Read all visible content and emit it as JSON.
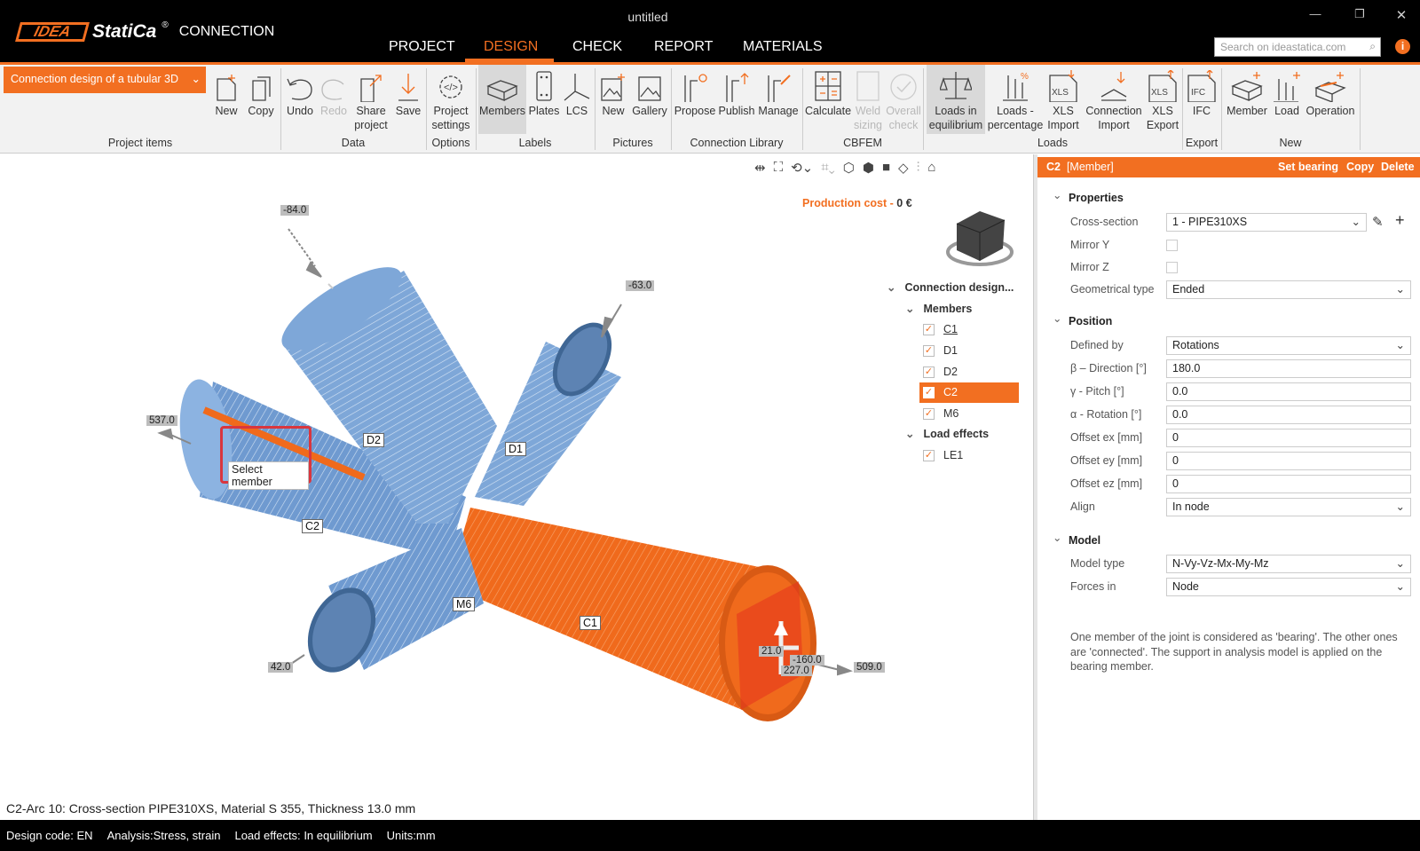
{
  "app": {
    "logo": "IDEA",
    "logo2": "StatiCa",
    "logo_reg": "®",
    "product": "CONNECTION",
    "window_title": "untitled",
    "search_placeholder": "Search on ideastatica.com"
  },
  "menu": [
    "PROJECT",
    "DESIGN",
    "CHECK",
    "REPORT",
    "MATERIALS"
  ],
  "ribbon": {
    "project_dropdown": "Connection design of a tubular 3D",
    "groups": {
      "project_items": "Project items",
      "data": "Data",
      "options": "Options",
      "labels": "Labels",
      "pictures": "Pictures",
      "connection_library": "Connection Library",
      "cbfem": "CBFEM",
      "loads": "Loads",
      "export": "Export",
      "new": "New"
    },
    "buttons": {
      "new": "New",
      "copy": "Copy",
      "undo": "Undo",
      "redo": "Redo",
      "share1": "Share",
      "share2": "project",
      "save": "Save",
      "ps1": "Project",
      "ps2": "settings",
      "members": "Members",
      "plates": "Plates",
      "lcs": "LCS",
      "pic_new": "New",
      "gallery": "Gallery",
      "propose": "Propose",
      "publish": "Publish",
      "manage": "Manage",
      "calculate": "Calculate",
      "weld1": "Weld",
      "weld2": "sizing",
      "overall1": "Overall",
      "overall2": "check",
      "lie1": "Loads in",
      "lie2": "equilibrium",
      "lp1": "Loads -",
      "lp2": "percentage",
      "xi1": "XLS",
      "xi2": "Import",
      "ci1": "Connection",
      "ci2": "Import",
      "xe1": "XLS",
      "xe2": "Export",
      "ifc": "IFC",
      "member": "Member",
      "load": "Load",
      "operation": "Operation"
    }
  },
  "viewport": {
    "production_cost_label": "Production cost",
    "production_cost_value": "0 €",
    "members": {
      "d2": "D2",
      "d1": "D1",
      "c2": "C2",
      "m6": "M6",
      "c1": "C1"
    },
    "loads": {
      "a": "-84.0",
      "b": "-63.0",
      "c": "537.0",
      "d": "42.0",
      "e": "509.0",
      "f": "21.0",
      "g": "-160.0",
      "h": "227.0"
    },
    "tooltip": "Select member"
  },
  "tree": {
    "root": "Connection design...",
    "members_label": "Members",
    "members": [
      "C1",
      "D1",
      "D2",
      "C2",
      "M6"
    ],
    "load_effects_label": "Load effects",
    "load_effects": [
      "LE1"
    ]
  },
  "panel": {
    "header_id": "C2",
    "header_type": "[Member]",
    "set_bearing": "Set bearing",
    "copy": "Copy",
    "delete": "Delete",
    "properties": "Properties",
    "cross_section_label": "Cross-section",
    "cross_section": "1 - PIPE310XS",
    "mirror_y": "Mirror Y",
    "mirror_z": "Mirror Z",
    "geom_type_label": "Geometrical type",
    "geom_type": "Ended",
    "position": "Position",
    "defined_by_label": "Defined by",
    "defined_by": "Rotations",
    "beta_label": "β – Direction [°]",
    "beta": "180.0",
    "gamma_label": "γ - Pitch [°]",
    "gamma": "0.0",
    "alpha_label": "α - Rotation [°]",
    "alpha": "0.0",
    "ex_label": "Offset ex [mm]",
    "ex": "0",
    "ey_label": "Offset ey [mm]",
    "ey": "0",
    "ez_label": "Offset ez [mm]",
    "ez": "0",
    "align_label": "Align",
    "align": "In node",
    "model": "Model",
    "model_type_label": "Model type",
    "model_type": "N-Vy-Vz-Mx-My-Mz",
    "forces_in_label": "Forces in",
    "forces_in": "Node",
    "note": "One member of the joint is considered as 'bearing'. The other ones are 'connected'. The support in analysis model is applied on the bearing member."
  },
  "status_message": "C2-Arc 10: Cross-section PIPE310XS, Material S 355, Thickness 13.0 mm",
  "statusbar": {
    "design_code_label": "Design code:",
    "design_code": "EN",
    "analysis_label": "Analysis:",
    "analysis": "Stress, strain",
    "load_effects_label": "Load effects:",
    "load_effects": "In equilibrium",
    "units_label": "Units:",
    "units": "mm"
  },
  "colors": {
    "accent": "#f26f21",
    "member_blue": "#7ea7d8",
    "bearing_orange": "#f06a1c"
  }
}
